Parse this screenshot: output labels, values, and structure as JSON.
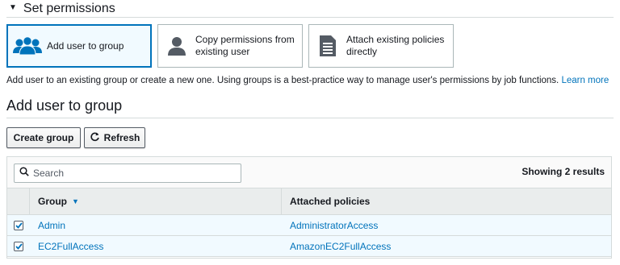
{
  "section": {
    "title": "Set permissions"
  },
  "options": [
    {
      "label": "Add user to group",
      "icon": "users-group-icon",
      "selected": true
    },
    {
      "label_line1": "Copy permissions from",
      "label_line2": "existing user",
      "icon": "user-icon"
    },
    {
      "label_line1": "Attach existing policies",
      "label_line2": "directly",
      "icon": "document-icon"
    }
  ],
  "description": {
    "text": "Add user to an existing group or create a new one. Using groups is a best-practice way to manage user's permissions by job functions. ",
    "link": "Learn more"
  },
  "subheading": "Add user to group",
  "buttons": {
    "create_group": "Create group",
    "refresh": "Refresh"
  },
  "search": {
    "placeholder": "Search",
    "value": ""
  },
  "results": "Showing 2 results",
  "table": {
    "columns": [
      "Group",
      "Attached policies"
    ],
    "rows": [
      {
        "group": "Admin",
        "policy": "AdministratorAccess",
        "checked": true
      },
      {
        "group": "EC2FullAccess",
        "policy": "AmazonEC2FullAccess",
        "checked": true
      }
    ]
  },
  "colors": {
    "accent": "#0073bb",
    "selected_bg": "#f1faff",
    "header_bg": "#eaeded"
  }
}
